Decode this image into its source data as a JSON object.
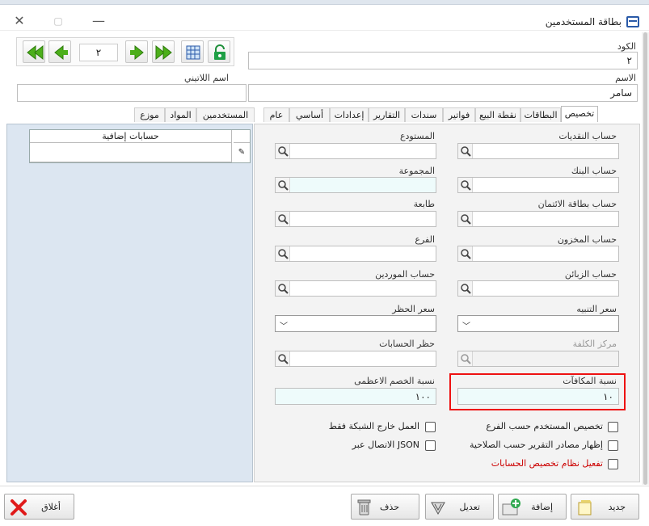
{
  "window": {
    "title": "بطاقة المستخدمين",
    "minimize_glyph": "—",
    "close_glyph": "✕",
    "restore_glyph": "▢"
  },
  "nav": {
    "record_number": "٢"
  },
  "fields": {
    "code": {
      "label": "الكود",
      "value": "٢"
    },
    "name": {
      "label": "الاسم",
      "value": "سامر"
    },
    "latin_name": {
      "label": "اسم اللاتيني",
      "value": ""
    }
  },
  "tabs": [
    "تخصيص",
    "البطاقات",
    "نقطة البيع",
    "فواتير",
    "سندات",
    "التقارير",
    "إعدادات",
    "أساسي",
    "عام",
    "المستخدمين",
    "المواد",
    "موزع"
  ],
  "active_tab": "تخصيص",
  "grid": {
    "header": "حسابات إضافية",
    "row_marker": "✎"
  },
  "right": {
    "cash_account": "حساب النقديات",
    "bank_account": "حساب البنك",
    "credit_card_account": "حساب بطاقة الائتمان",
    "stock_account": "حساب المخزون",
    "customers_account": "حساب الزبائن",
    "alert_price": "سعر التنبيه",
    "cost_center": "مركز الكلفة",
    "bonus_ratio": {
      "label": "نسبة المكافآت",
      "value": "١٠"
    }
  },
  "middle": {
    "warehouse": "المستودع",
    "group": "المجموعة",
    "printer": "طابعة",
    "branch": "الفرع",
    "suppliers_account": "حساب الموردين",
    "block_price": "سعر الحظر",
    "block_accounts": "حظر الحسابات",
    "max_discount": {
      "label": "نسبة الخصم الاعظمى",
      "value": "١٠٠"
    }
  },
  "checks": {
    "branch_assign": "تخصيص المستخدم حسب الفرع",
    "show_report_sources": "إظهار مصادر التقرير حسب الصلاحية",
    "enable_account_assign": "تفعيل نظام تخصيص الحسابات",
    "offline_work": "العمل خارج الشبكة فقط",
    "json_connect": "الاتصال عبر JSON"
  },
  "buttons": {
    "new": "جديد",
    "add": "إضافة",
    "edit": "تعديل",
    "delete": "حذف",
    "close": "أغلاق"
  },
  "colors": {
    "highlight_border": "#e11111",
    "accent_red_text": "#cc0000",
    "left_panel_bg": "#dce6f1",
    "tint_input": "#eefbfb"
  }
}
